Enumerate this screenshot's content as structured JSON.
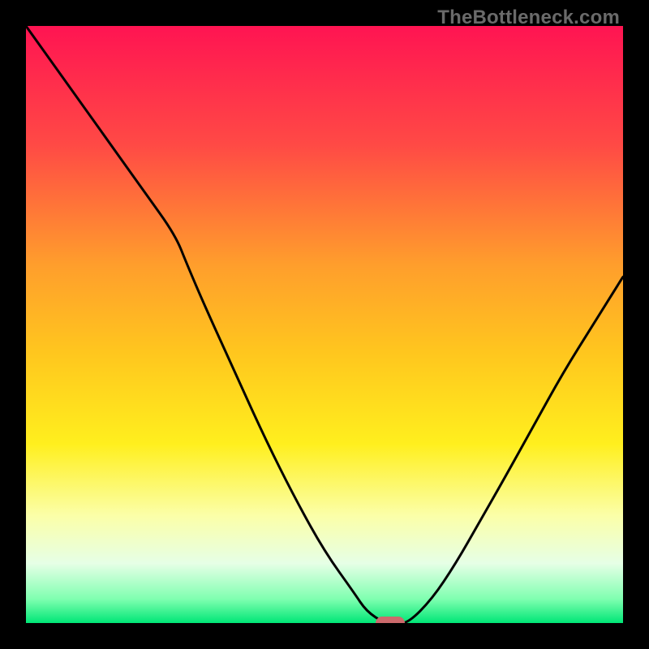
{
  "watermark": {
    "text": "TheBottleneck.com"
  },
  "colors": {
    "background": "#000000",
    "curve": "#000000",
    "marker": "#cc6a6c",
    "gradient_stops": [
      {
        "offset": 0.0,
        "color": "#ff1452"
      },
      {
        "offset": 0.2,
        "color": "#ff4a45"
      },
      {
        "offset": 0.4,
        "color": "#ff9e2c"
      },
      {
        "offset": 0.55,
        "color": "#ffc71e"
      },
      {
        "offset": 0.7,
        "color": "#ffef1e"
      },
      {
        "offset": 0.82,
        "color": "#fbffa8"
      },
      {
        "offset": 0.9,
        "color": "#e6ffe6"
      },
      {
        "offset": 0.96,
        "color": "#7fffb0"
      },
      {
        "offset": 1.0,
        "color": "#00e676"
      }
    ]
  },
  "chart_data": {
    "type": "line",
    "title": "",
    "xlabel": "",
    "ylabel": "",
    "xlim": [
      0,
      100
    ],
    "ylim": [
      0,
      100
    ],
    "grid": false,
    "legend": false,
    "categories": [
      0,
      5,
      10,
      15,
      20,
      25,
      27,
      30,
      35,
      40,
      45,
      50,
      55,
      57,
      60,
      62,
      64,
      68,
      72,
      76,
      80,
      85,
      90,
      95,
      100
    ],
    "series": [
      {
        "name": "bottleneck-curve",
        "values": [
          100,
          93,
          86,
          79,
          72,
          65,
          60,
          53,
          42,
          31,
          21,
          12,
          5,
          2,
          0,
          0,
          0,
          4,
          10,
          17,
          24,
          33,
          42,
          50,
          58
        ]
      }
    ],
    "marker": {
      "x": 61,
      "y": 0,
      "width": 5,
      "height": 2.2
    }
  }
}
